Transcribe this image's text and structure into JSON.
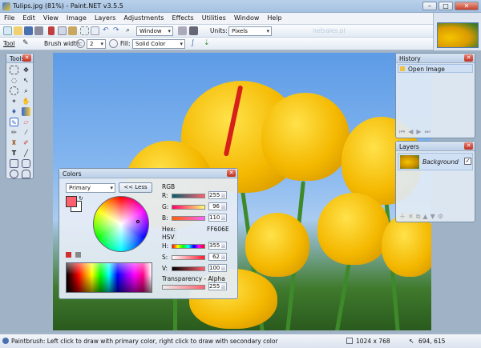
{
  "window": {
    "title": "Tulips.jpg (81%) - Paint.NET v3.5.5",
    "minimize": "–",
    "maximize": "□",
    "close": "✕"
  },
  "menu": [
    "File",
    "Edit",
    "View",
    "Image",
    "Layers",
    "Adjustments",
    "Effects",
    "Utilities",
    "Window",
    "Help"
  ],
  "toolbar1": {
    "zoom": "Window",
    "units_label": "Units:",
    "units": "Pixels"
  },
  "toolbar2": {
    "tool_label": "Tool",
    "brush_label": "Brush width:",
    "brush_value": "2",
    "fill_label": "Fill:",
    "fill_value": "Solid Color"
  },
  "watermark": "netsales.pl",
  "tools": {
    "title": "Tools"
  },
  "history": {
    "title": "History",
    "items": [
      "Open Image"
    ]
  },
  "layers": {
    "title": "Layers",
    "items": [
      {
        "name": "Background",
        "checked": "✓"
      }
    ]
  },
  "colors": {
    "title": "Colors",
    "palette_select": "Primary",
    "less_button": "<< Less",
    "rgb_label": "RGB",
    "r_label": "R:",
    "r": "255",
    "g_label": "G:",
    "g": "96",
    "b_label": "B:",
    "b": "110",
    "hex_label": "Hex:",
    "hex": "FF606E",
    "hsv_label": "HSV",
    "h_label": "H:",
    "h": "355",
    "s_label": "S:",
    "s": "62",
    "v_label": "V:",
    "v": "100",
    "alpha_label": "Transparency - Alpha",
    "alpha": "255",
    "primary_color": "#FF606E",
    "secondary_color": "#FFFFFF"
  },
  "status": {
    "hint": "Paintbrush: Left click to draw with primary color, right click to draw with secondary color",
    "size": "1024 x 768",
    "coords": "694, 615"
  }
}
